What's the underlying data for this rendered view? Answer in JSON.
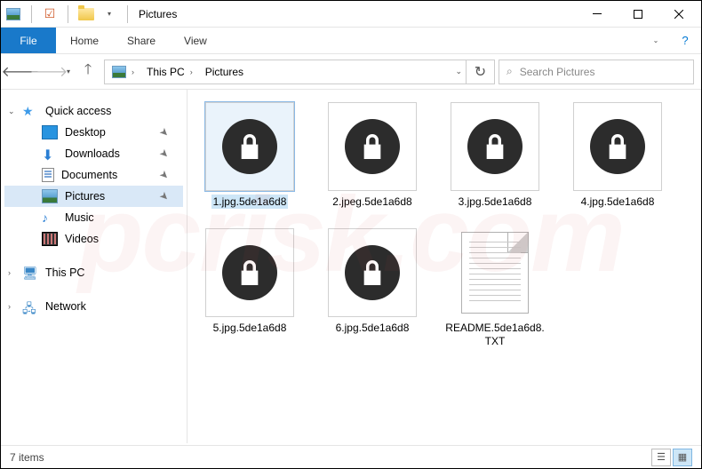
{
  "titlebar": {
    "title": "Pictures"
  },
  "ribbon": {
    "file": "File",
    "tabs": [
      "Home",
      "Share",
      "View"
    ]
  },
  "breadcrumb": {
    "segments": [
      "This PC",
      "Pictures"
    ]
  },
  "search": {
    "placeholder": "Search Pictures"
  },
  "sidebar": {
    "quick_access": "Quick access",
    "items": [
      {
        "label": "Desktop",
        "icon": "desktop"
      },
      {
        "label": "Downloads",
        "icon": "dl"
      },
      {
        "label": "Documents",
        "icon": "doc"
      },
      {
        "label": "Pictures",
        "icon": "pic",
        "selected": true
      },
      {
        "label": "Music",
        "icon": "music"
      },
      {
        "label": "Videos",
        "icon": "vid"
      }
    ],
    "this_pc": "This PC",
    "network": "Network"
  },
  "files": [
    {
      "name": "1.jpg.5de1a6d8",
      "type": "locked",
      "selected": true
    },
    {
      "name": "2.jpeg.5de1a6d8",
      "type": "locked"
    },
    {
      "name": "3.jpg.5de1a6d8",
      "type": "locked"
    },
    {
      "name": "4.jpg.5de1a6d8",
      "type": "locked"
    },
    {
      "name": "5.jpg.5de1a6d8",
      "type": "locked"
    },
    {
      "name": "6.jpg.5de1a6d8",
      "type": "locked"
    },
    {
      "name": "README.5de1a6d8.TXT",
      "type": "txt"
    }
  ],
  "status": {
    "count": "7 items"
  }
}
